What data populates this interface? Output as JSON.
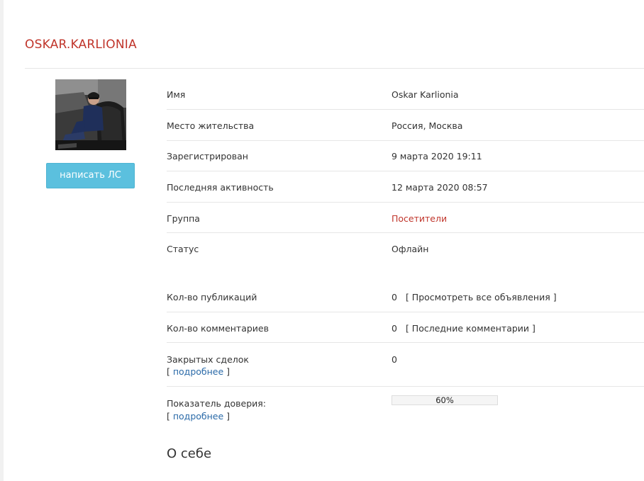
{
  "profile": {
    "username": "OSKAR.KARLIONIA",
    "pm_button": "написать ЛС"
  },
  "fields": {
    "name": {
      "label": "Имя",
      "value": "Oskar Karlionia"
    },
    "location": {
      "label": "Место жительства",
      "value": "Россия, Москва"
    },
    "registered": {
      "label": "Зарегистрирован",
      "value": "9 марта 2020 19:11"
    },
    "last_activity": {
      "label": "Последняя активность",
      "value": "12 марта 2020 08:57"
    },
    "group": {
      "label": "Группа",
      "value": "Посетители"
    },
    "status": {
      "label": "Статус",
      "value": "Офлайн"
    }
  },
  "stats": {
    "publications": {
      "label": "Кол-во публикаций",
      "value": "0",
      "link": "[ Просмотреть все объявления ]"
    },
    "comments": {
      "label": "Кол-во комментариев",
      "value": "0",
      "link": "[ Последние комментарии ]"
    },
    "deals": {
      "label": "Закрытых сделок",
      "value": "0",
      "more_open": "[ ",
      "more_link": "подробнее",
      "more_close": " ]"
    },
    "trust": {
      "label": "Показатель доверия:",
      "percent_text": "60%",
      "percent": 60,
      "more_open": "[ ",
      "more_link": "подробнее",
      "more_close": " ]"
    }
  },
  "about": {
    "title": "О себе"
  },
  "colors": {
    "accent_red": "#c0352b",
    "button_blue": "#5bc0de",
    "link_blue": "#2a6aa8"
  }
}
